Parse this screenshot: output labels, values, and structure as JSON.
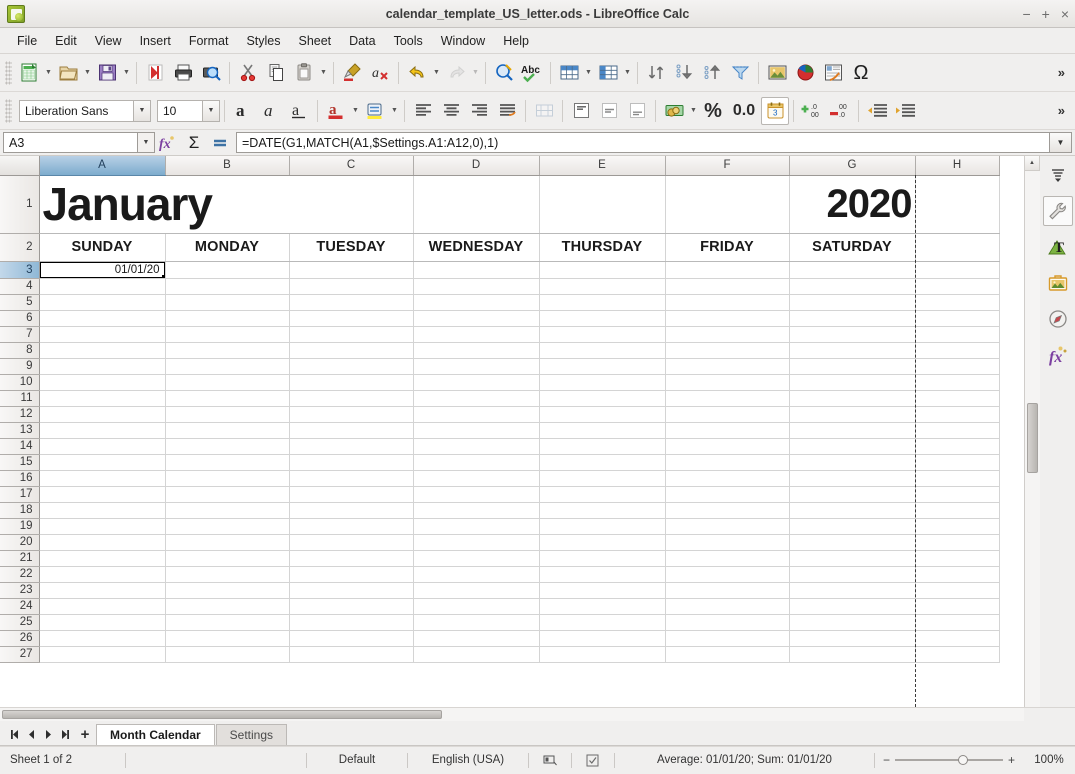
{
  "window": {
    "title": "calendar_template_US_letter.ods - LibreOffice Calc",
    "app_icon": "calc-document-icon",
    "minimize": "−",
    "maximize": "+",
    "close": "×"
  },
  "menubar": {
    "items": [
      "File",
      "Edit",
      "View",
      "Insert",
      "Format",
      "Styles",
      "Sheet",
      "Data",
      "Tools",
      "Window",
      "Help"
    ]
  },
  "toolbar_standard": {
    "overflow": "»",
    "items": [
      {
        "name": "new-document",
        "tip": "New"
      },
      {
        "name": "open-document",
        "tip": "Open"
      },
      {
        "name": "save-document",
        "tip": "Save"
      },
      {
        "name": "export-pdf",
        "tip": "Export as PDF"
      },
      {
        "name": "print",
        "tip": "Print"
      },
      {
        "name": "print-preview",
        "tip": "Toggle Print Preview"
      },
      {
        "name": "cut",
        "tip": "Cut"
      },
      {
        "name": "copy",
        "tip": "Copy"
      },
      {
        "name": "paste",
        "tip": "Paste"
      },
      {
        "name": "clone-formatting",
        "tip": "Clone Formatting"
      },
      {
        "name": "clear-formatting",
        "tip": "Clear Direct Formatting"
      },
      {
        "name": "undo",
        "tip": "Undo"
      },
      {
        "name": "redo",
        "tip": "Redo"
      },
      {
        "name": "find-and-replace",
        "tip": "Find and Replace"
      },
      {
        "name": "spelling",
        "tip": "Spelling",
        "label": "Abc"
      },
      {
        "name": "row",
        "tip": "Row"
      },
      {
        "name": "column",
        "tip": "Column"
      },
      {
        "name": "sort",
        "tip": "Sort"
      },
      {
        "name": "sort-ascending",
        "tip": "Sort Ascending"
      },
      {
        "name": "sort-descending",
        "tip": "Sort Descending"
      },
      {
        "name": "autofilter",
        "tip": "AutoFilter"
      },
      {
        "name": "insert-image",
        "tip": "Insert Image"
      },
      {
        "name": "insert-chart",
        "tip": "Insert Chart"
      },
      {
        "name": "pivot-table",
        "tip": "Insert or Edit Pivot Table"
      },
      {
        "name": "special-character",
        "tip": "Insert Special Character",
        "label": "Ω"
      }
    ]
  },
  "toolbar_formatting": {
    "font_name": "Liberation Sans",
    "font_size": "10",
    "overflow": "»",
    "percent_label": "%",
    "number_label": "0.0",
    "items": [
      {
        "name": "bold",
        "label": "a"
      },
      {
        "name": "italic",
        "label": "a"
      },
      {
        "name": "underline",
        "label": "a"
      },
      {
        "name": "font-color",
        "label": "a"
      },
      {
        "name": "highlighting-color",
        "label": "a"
      },
      {
        "name": "align-left"
      },
      {
        "name": "align-center"
      },
      {
        "name": "align-right"
      },
      {
        "name": "align-justified"
      },
      {
        "name": "merge-cells"
      },
      {
        "name": "align-top"
      },
      {
        "name": "align-center-vertically"
      },
      {
        "name": "align-bottom"
      },
      {
        "name": "format-as-currency"
      },
      {
        "name": "format-as-percent"
      },
      {
        "name": "format-as-number"
      },
      {
        "name": "format-as-date"
      },
      {
        "name": "add-decimal-place"
      },
      {
        "name": "delete-decimal-place"
      },
      {
        "name": "decrease-indent"
      },
      {
        "name": "increase-indent"
      }
    ]
  },
  "formula_bar": {
    "name_box": "A3",
    "formula": "=DATE(G1,MATCH(A1,$Settings.A1:A12,0),1)",
    "function_wizard": "fx",
    "sum": "Σ",
    "formula_icon": "=",
    "expand": "▼"
  },
  "sheet": {
    "columns": [
      "A",
      "B",
      "C",
      "D",
      "E",
      "F",
      "G",
      "H"
    ],
    "selected_column": "A",
    "selected_row": 3,
    "rows": [
      1,
      2,
      3,
      4,
      5,
      6,
      7,
      8,
      9,
      10,
      11,
      12,
      13,
      14,
      15,
      16,
      17,
      18,
      19,
      20,
      21,
      22,
      23,
      24,
      25,
      26,
      27
    ],
    "title_row": {
      "month": "January",
      "year": "2020"
    },
    "weekday_headers": [
      "SUNDAY",
      "MONDAY",
      "TUESDAY",
      "WEDNESDAY",
      "THURSDAY",
      "FRIDAY",
      "SATURDAY"
    ],
    "selected_cell_value": "01/01/20"
  },
  "sidebar": {
    "items": [
      {
        "name": "sidebar-settings",
        "tip": "Sidebar Settings"
      },
      {
        "name": "properties",
        "tip": "Properties"
      },
      {
        "name": "styles",
        "tip": "Styles"
      },
      {
        "name": "gallery",
        "tip": "Gallery"
      },
      {
        "name": "navigator",
        "tip": "Navigator"
      },
      {
        "name": "functions",
        "tip": "Functions"
      }
    ]
  },
  "tabbar": {
    "first": "⏮",
    "prev": "◀",
    "next": "▶",
    "last": "⏭",
    "add": "+",
    "sheets": [
      {
        "label": "Month Calendar",
        "active": true
      },
      {
        "label": "Settings",
        "active": false
      }
    ]
  },
  "statusbar": {
    "sheet_count": "Sheet 1 of 2",
    "page_style": "Default",
    "language": "English (USA)",
    "selection_mode": "selection-mode-icon",
    "document_modified": "document-modified-icon",
    "summary": "Average: 01/01/20; Sum: 01/01/20",
    "zoom_out": "−",
    "zoom_in": "+",
    "zoom_level": "100%"
  },
  "colors": {
    "selection_header": "#7daccd",
    "accent": "#2a6099",
    "grid_line": "#d4d4d4"
  }
}
